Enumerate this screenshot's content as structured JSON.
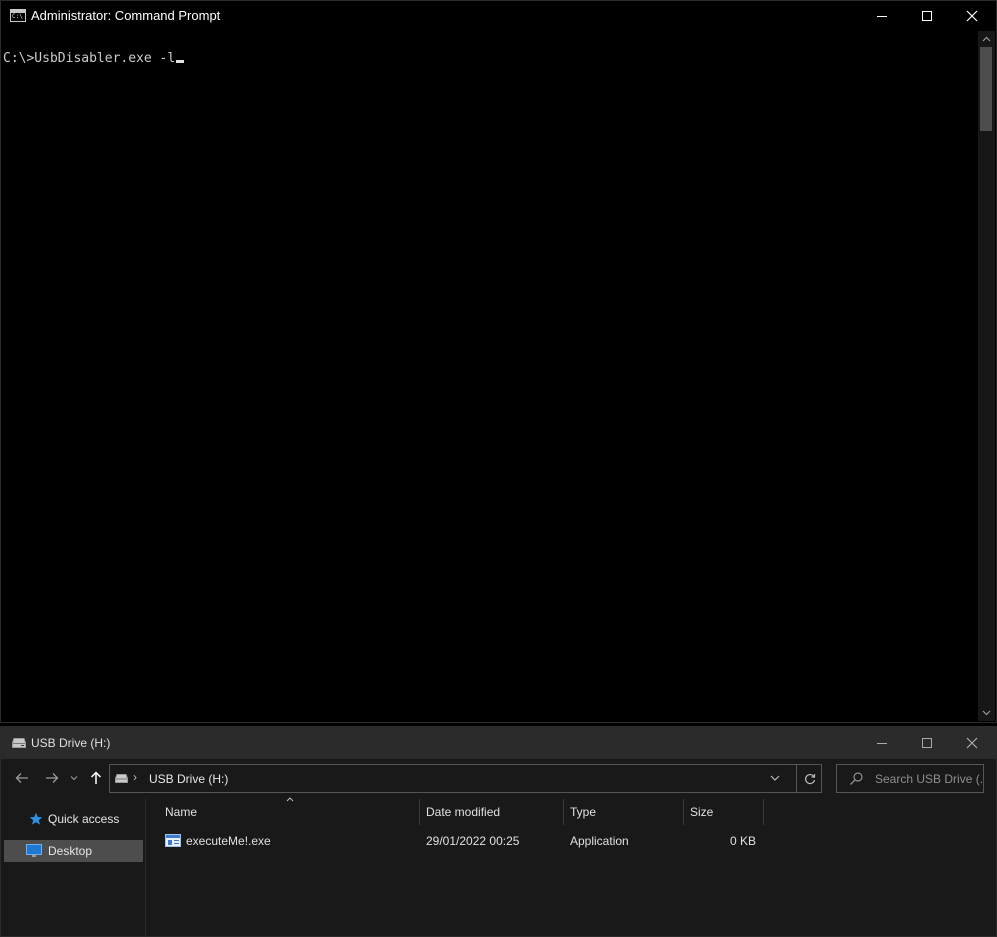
{
  "cmd": {
    "title": "Administrator: Command Prompt",
    "icon": "cmd-icon",
    "icon_text": "C:\\",
    "command_line": "C:\\>UsbDisabler.exe -l"
  },
  "explorer": {
    "title": "USB Drive (H:)",
    "address": {
      "separator": "›",
      "path": "USB Drive (H:)"
    },
    "search": {
      "placeholder": "Search USB Drive (..."
    },
    "nav_pane": {
      "items": [
        {
          "label": "Quick access",
          "icon": "star-icon"
        },
        {
          "label": "Desktop",
          "icon": "desktop-icon",
          "selected": true
        }
      ]
    },
    "columns": [
      "Name",
      "Date modified",
      "Type",
      "Size"
    ],
    "files": [
      {
        "name": "executeMe!.exe",
        "date_modified": "29/01/2022 00:25",
        "type": "Application",
        "size": "0 KB"
      }
    ]
  }
}
